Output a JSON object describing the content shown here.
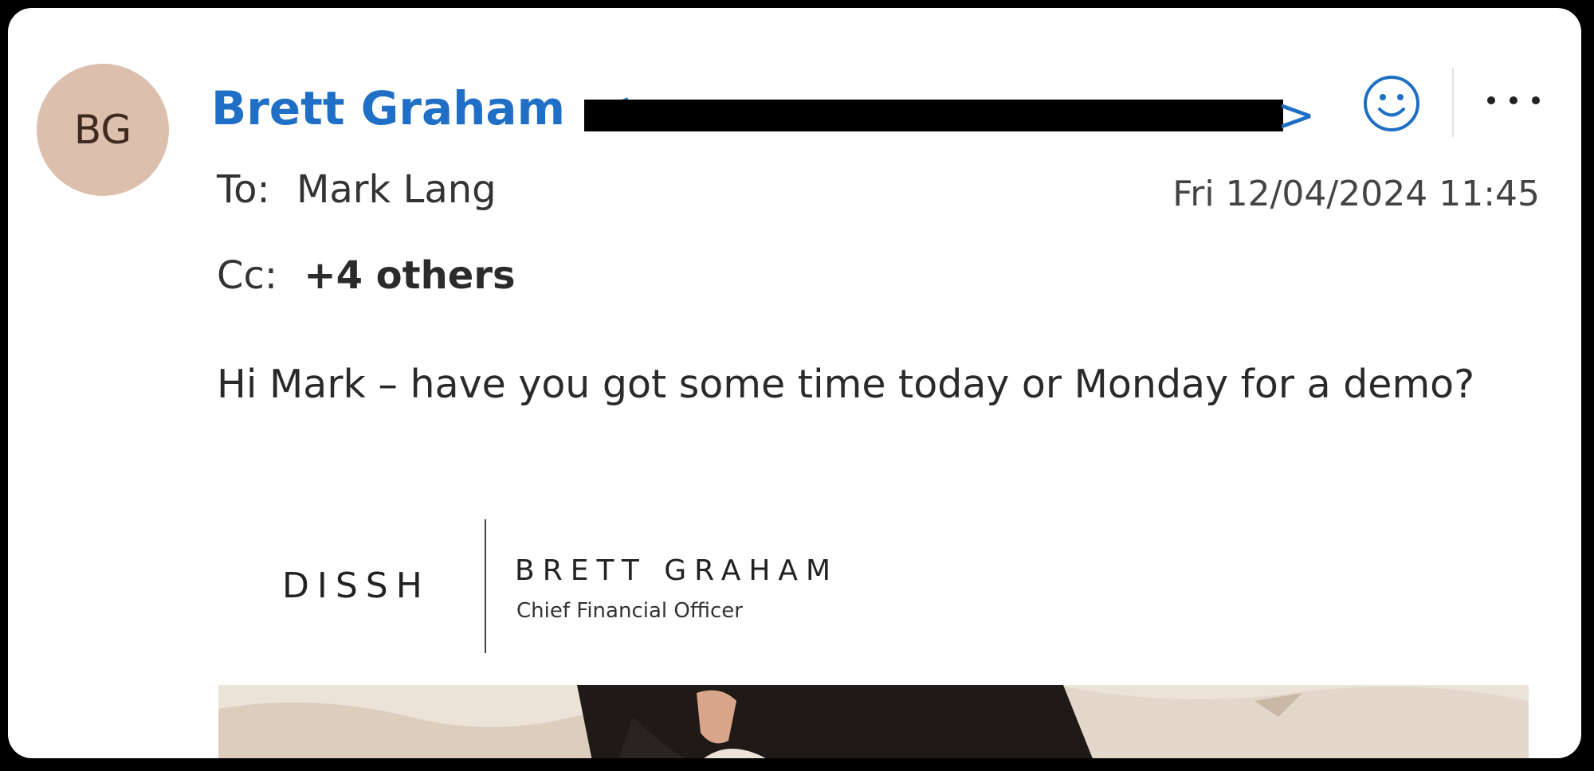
{
  "sender": {
    "initials": "BG",
    "name": "Brett Graham",
    "email_open": "<",
    "email_close": ">"
  },
  "recipients": {
    "to_label": "To:",
    "to_name": "Mark Lang",
    "cc_label": "Cc:",
    "cc_summary": "+4 others"
  },
  "timestamp": "Fri 12/04/2024 11:45",
  "actions": {
    "react_icon": "smiley-icon",
    "more_icon": "more-horizontal-icon"
  },
  "message": {
    "body": "Hi Mark – have you got some time today or Monday for a demo?"
  },
  "signature": {
    "logo": "DISSH",
    "name": "BRETT GRAHAM",
    "title": "Chief Financial Officer"
  },
  "colors": {
    "sender_blue": "#1e6fc5",
    "avatar_bg": "#dcbfad"
  }
}
